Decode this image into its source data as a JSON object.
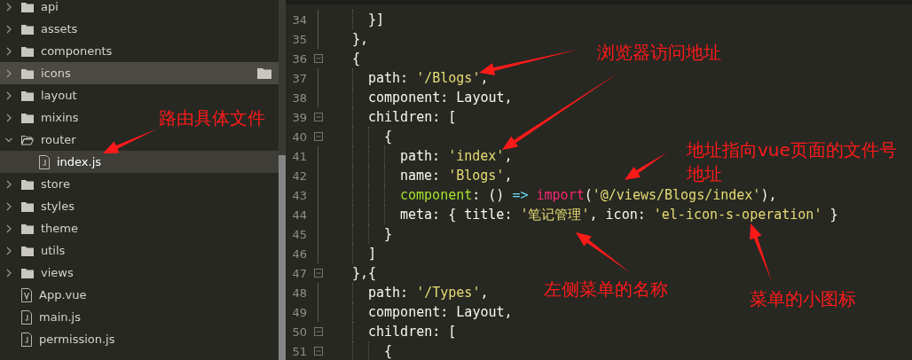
{
  "sidebar": {
    "items": [
      {
        "label": "api",
        "kind": "folder",
        "expanded": false,
        "selected": false,
        "hovered": false
      },
      {
        "label": "assets",
        "kind": "folder",
        "expanded": false,
        "selected": false,
        "hovered": false
      },
      {
        "label": "components",
        "kind": "folder",
        "expanded": false,
        "selected": false,
        "hovered": false
      },
      {
        "label": "icons",
        "kind": "folder",
        "expanded": false,
        "selected": false,
        "hovered": true
      },
      {
        "label": "layout",
        "kind": "folder",
        "expanded": false,
        "selected": false,
        "hovered": false
      },
      {
        "label": "mixins",
        "kind": "folder",
        "expanded": false,
        "selected": false,
        "hovered": false
      },
      {
        "label": "router",
        "kind": "folder",
        "expanded": true,
        "selected": false,
        "hovered": false,
        "children": [
          {
            "label": "index.js",
            "kind": "js",
            "selected": true,
            "hovered": false
          }
        ]
      },
      {
        "label": "store",
        "kind": "folder",
        "expanded": false,
        "selected": false,
        "hovered": false
      },
      {
        "label": "styles",
        "kind": "folder",
        "expanded": false,
        "selected": false,
        "hovered": false
      },
      {
        "label": "theme",
        "kind": "folder",
        "expanded": false,
        "selected": false,
        "hovered": false
      },
      {
        "label": "utils",
        "kind": "folder",
        "expanded": false,
        "selected": false,
        "hovered": false
      },
      {
        "label": "views",
        "kind": "folder",
        "expanded": false,
        "selected": false,
        "hovered": false
      },
      {
        "label": "App.vue",
        "kind": "vue",
        "selected": false,
        "hovered": false
      },
      {
        "label": "main.js",
        "kind": "js",
        "selected": false,
        "hovered": false
      },
      {
        "label": "permission.js",
        "kind": "js",
        "selected": false,
        "hovered": false
      }
    ]
  },
  "editor": {
    "lines": [
      {
        "number": "34",
        "fold": false,
        "tokens": [
          {
            "text": "    }]",
            "kind": "plain"
          }
        ]
      },
      {
        "number": "35",
        "fold": false,
        "tokens": [
          {
            "text": "  },",
            "kind": "plain"
          }
        ]
      },
      {
        "number": "36",
        "fold": true,
        "tokens": [
          {
            "text": "  {",
            "kind": "plain"
          }
        ]
      },
      {
        "number": "37",
        "fold": false,
        "tokens": [
          {
            "text": "    path: ",
            "kind": "plain"
          },
          {
            "text": "'/Blogs'",
            "kind": "string"
          },
          {
            "text": ",",
            "kind": "plain"
          }
        ]
      },
      {
        "number": "38",
        "fold": false,
        "tokens": [
          {
            "text": "    component: Layout,",
            "kind": "plain"
          }
        ]
      },
      {
        "number": "39",
        "fold": true,
        "tokens": [
          {
            "text": "    children: [",
            "kind": "plain"
          }
        ]
      },
      {
        "number": "40",
        "fold": true,
        "tokens": [
          {
            "text": "      {",
            "kind": "plain"
          }
        ]
      },
      {
        "number": "41",
        "fold": false,
        "tokens": [
          {
            "text": "        path: ",
            "kind": "plain"
          },
          {
            "text": "'index'",
            "kind": "string"
          },
          {
            "text": ",",
            "kind": "plain"
          }
        ]
      },
      {
        "number": "42",
        "fold": false,
        "tokens": [
          {
            "text": "        name: ",
            "kind": "plain"
          },
          {
            "text": "'Blogs'",
            "kind": "string"
          },
          {
            "text": ",",
            "kind": "plain"
          }
        ]
      },
      {
        "number": "43",
        "fold": false,
        "tokens": [
          {
            "text": "        component",
            "kind": "function"
          },
          {
            "text": ": () ",
            "kind": "plain"
          },
          {
            "text": "=>",
            "kind": "operator"
          },
          {
            "text": " import",
            "kind": "keyword"
          },
          {
            "text": "(",
            "kind": "plain"
          },
          {
            "text": "'@/views/Blogs/index'",
            "kind": "string"
          },
          {
            "text": "),",
            "kind": "plain"
          }
        ]
      },
      {
        "number": "44",
        "fold": false,
        "tokens": [
          {
            "text": "        meta: { title: ",
            "kind": "plain"
          },
          {
            "text": "'笔记管理'",
            "kind": "string"
          },
          {
            "text": ", icon: ",
            "kind": "plain"
          },
          {
            "text": "'el-icon-s-operation'",
            "kind": "string"
          },
          {
            "text": " }",
            "kind": "plain"
          }
        ]
      },
      {
        "number": "45",
        "fold": false,
        "tokens": [
          {
            "text": "      }",
            "kind": "plain"
          }
        ]
      },
      {
        "number": "46",
        "fold": false,
        "tokens": [
          {
            "text": "    ]",
            "kind": "plain"
          }
        ]
      },
      {
        "number": "47",
        "fold": true,
        "tokens": [
          {
            "text": "  },{",
            "kind": "plain"
          }
        ]
      },
      {
        "number": "48",
        "fold": false,
        "tokens": [
          {
            "text": "    path: ",
            "kind": "plain"
          },
          {
            "text": "'/Types'",
            "kind": "string"
          },
          {
            "text": ",",
            "kind": "plain"
          }
        ]
      },
      {
        "number": "49",
        "fold": false,
        "tokens": [
          {
            "text": "    component: Layout,",
            "kind": "plain"
          }
        ]
      },
      {
        "number": "50",
        "fold": true,
        "tokens": [
          {
            "text": "    children: [",
            "kind": "plain"
          }
        ]
      },
      {
        "number": "51",
        "fold": true,
        "tokens": [
          {
            "text": "      {",
            "kind": "plain"
          }
        ]
      }
    ]
  },
  "annotations": [
    {
      "text": "浏览器访问地址"
    },
    {
      "text": "路由具体文件"
    },
    {
      "text": "地址指向vue页面的文件号地址"
    },
    {
      "text": "左侧菜单的名称"
    },
    {
      "text": "菜单的小图标"
    }
  ]
}
